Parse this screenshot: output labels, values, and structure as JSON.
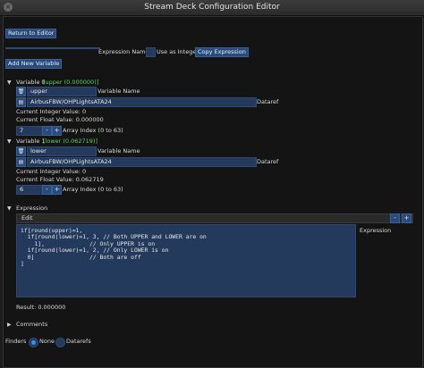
{
  "window": {
    "title": "Stream Deck Configuration Editor",
    "close_glyph": "×"
  },
  "top": {
    "return_label": "Return to Editor",
    "expression_name_value": "",
    "expression_name_label": "Expression Name",
    "use_integer_label": "Use as Integer",
    "copy_expression_label": "Copy Expression",
    "add_variable_label": "Add New Variable"
  },
  "variables": [
    {
      "header": "Variable 0",
      "tag": "[upper (0.000000)]",
      "name_value": "upper",
      "name_label": "Variable Name",
      "dataref_value": "AirbusFBW/OHPLightsATA24",
      "dataref_label": "Dataref",
      "int_value": "Current Integer Value: 0",
      "float_value": "Current Float Value: 0.000000",
      "index_value": "7",
      "index_label": "Array Index (0 to 63)"
    },
    {
      "header": "Variable 1",
      "tag": "[lower (0.062719)]",
      "name_value": "lower",
      "name_label": "Variable Name",
      "dataref_value": "AirbusFBW/OHPLightsATA24",
      "dataref_label": "Dataref",
      "int_value": "Current Integer Value: 0",
      "float_value": "Current Float Value: 0.062719",
      "index_value": "6",
      "index_label": "Array Index (0 to 63)"
    }
  ],
  "expression": {
    "header": "Expression",
    "edit_label": "Edit",
    "minus": "-",
    "plus": "+",
    "code": "if[round(upper)=1,\n  if[round(lower)=1, 3, // Both UPPER and LOWER are on\n    1],             // Only UPPER is on\n  if[round(lower)=1, 2, // Only LOWER is on\n  0]                // Both are off\n]",
    "side_label": "Expression",
    "result": "Result: 0.000000"
  },
  "comments": {
    "header": "Comments"
  },
  "finders": {
    "label": "Finders",
    "options": [
      "None",
      "Datarefs"
    ],
    "selected": "None"
  },
  "icons": {
    "delete": "trash-icon",
    "file": "file-icon",
    "expand": "triangle-down-icon",
    "collapse": "triangle-right-icon"
  }
}
